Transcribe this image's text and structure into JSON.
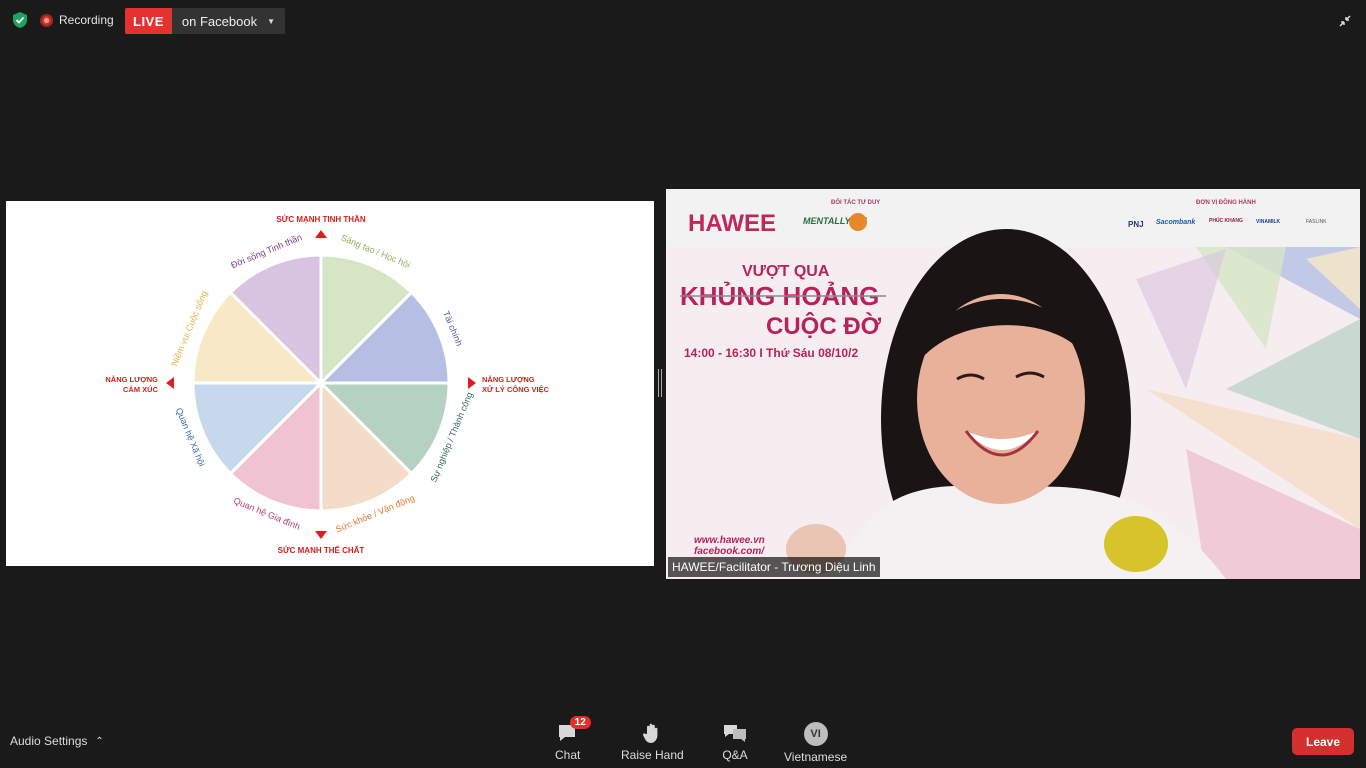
{
  "topbar": {
    "recording_label": "Recording",
    "live_badge": "LIVE",
    "live_target": "on Facebook"
  },
  "wheel": {
    "top_label": "SỨC MẠNH TINH THẦN",
    "bottom_label": "SỨC MẠNH THỂ CHẤT",
    "left_label_line1": "NĂNG LƯỢNG",
    "left_label_line2": "CẢM XÚC",
    "right_label_line1": "NĂNG LƯỢNG",
    "right_label_line2": "XỬ LÝ CÔNG VIỆC",
    "segments": [
      {
        "label": "Sáng tạo / Học hỏi",
        "color": "#d6e6c5",
        "text_color": "#8bb35a"
      },
      {
        "label": "Tài chính",
        "color": "#b5bfe4",
        "text_color": "#4a5aa8"
      },
      {
        "label": "Sự nghiệp / Thành công",
        "color": "#b5d1c2",
        "text_color": "#2f6b4d"
      },
      {
        "label": "Sức khỏe / Vận động",
        "color": "#f5dcc8",
        "text_color": "#e07a2e"
      },
      {
        "label": "Quan hệ Gia đình",
        "color": "#f0c3d3",
        "text_color": "#b0406e"
      },
      {
        "label": "Quan hệ Xã hội",
        "color": "#c6d9ec",
        "text_color": "#3a6aa6"
      },
      {
        "label": "Niềm vui Cuộc sống",
        "color": "#f7e8c6",
        "text_color": "#e0b440"
      },
      {
        "label": "Đời sống Tinh thần",
        "color": "#d8c3e0",
        "text_color": "#7a3c8e"
      }
    ],
    "arrow_color": "#e21c1c"
  },
  "video": {
    "brand": "HAWEE",
    "partner_label": "ĐỐI TÁC TƯ DUY",
    "partner_name": "MENTALLY FIT",
    "sponsor_label": "ĐƠN VỊ ĐỒNG HÀNH",
    "sponsors": [
      "PNJ",
      "Sacombank",
      "PHÚC KHANG",
      "VINAMILK",
      "FASLINK"
    ],
    "title_line1": "VƯỢT QUA",
    "title_line2": "KHỦNG HOẢNG",
    "title_line3": "CUỘC ĐỜ",
    "time_line": "14:00 - 16:30  I  Thứ Sáu 08/10/2",
    "website": "www.hawee.vn",
    "facebook": "facebook.com/",
    "participant_name": "HAWEE/Facilitator - Trương Diệu Linh"
  },
  "bottombar": {
    "audio_settings": "Audio Settings",
    "chat_label": "Chat",
    "chat_count": "12",
    "raise_hand_label": "Raise Hand",
    "qa_label": "Q&A",
    "language_code": "VI",
    "language_label": "Vietnamese",
    "leave_label": "Leave"
  }
}
